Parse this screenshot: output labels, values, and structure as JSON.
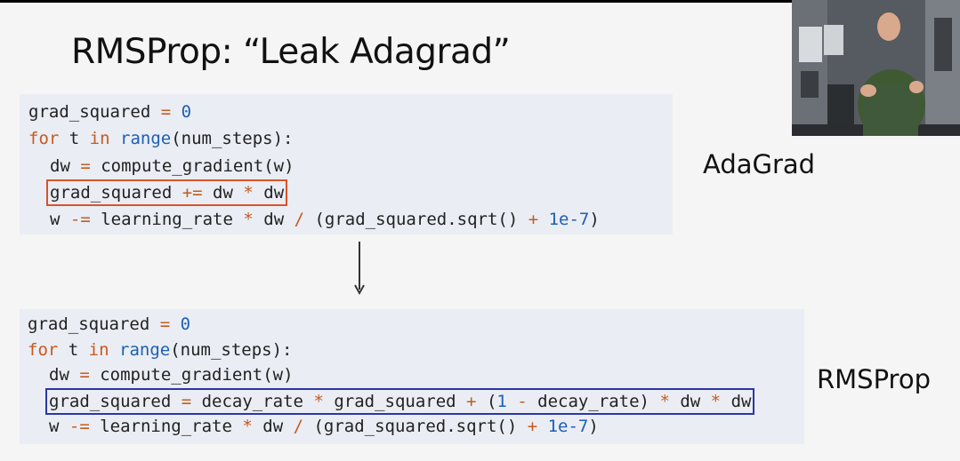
{
  "title": "RMSProp: “Leak Adagrad”",
  "labels": {
    "top": "AdaGrad",
    "bottom": "RMSProp"
  },
  "colors": {
    "keyword": "#c65a1f",
    "builtin": "#1d5fb5",
    "adagrad_box": "#d9532a",
    "rmsprop_box": "#2b36a8"
  },
  "adagrad_code": {
    "l1_a": "grad_squared",
    "l1_eq": " = ",
    "l1_num": "0",
    "l2_for": "for",
    "l2_t": " t ",
    "l2_in": "in",
    "l2_sp": " ",
    "l2_range": "range",
    "l2_rest": "(num_steps):",
    "l3_a": "dw",
    "l3_eq": " = ",
    "l3_b": "compute_gradient(w)",
    "l4_a": "grad_squared",
    "l4_op1": " += ",
    "l4_b": "dw",
    "l4_op2": " * ",
    "l4_c": "dw",
    "l5_a": "w",
    "l5_op1": " -= ",
    "l5_b": "learning_rate",
    "l5_op2": " * ",
    "l5_c": "dw",
    "l5_op3": " / ",
    "l5_d": "(grad_squared.sqrt()",
    "l5_op4": " + ",
    "l5_num": "1e-7",
    "l5_end": ")"
  },
  "rmsprop_code": {
    "l1_a": "grad_squared",
    "l1_eq": " = ",
    "l1_num": "0",
    "l2_for": "for",
    "l2_t": " t ",
    "l2_in": "in",
    "l2_sp": " ",
    "l2_range": "range",
    "l2_rest": "(num_steps):",
    "l3_a": "dw",
    "l3_eq": " = ",
    "l3_b": "compute_gradient(w)",
    "l4_a": "grad_squared",
    "l4_eq": " = ",
    "l4_b": "decay_rate",
    "l4_op1": " * ",
    "l4_c": "grad_squared",
    "l4_op2": " + ",
    "l4_d": "(",
    "l4_num": "1",
    "l4_op3": " - ",
    "l4_e": "decay_rate)",
    "l4_op4": " * ",
    "l4_f": "dw",
    "l4_op5": " * ",
    "l4_g": "dw",
    "l5_a": "w",
    "l5_op1": " -= ",
    "l5_b": "learning_rate",
    "l5_op2": " * ",
    "l5_c": "dw",
    "l5_op3": " / ",
    "l5_d": "(grad_squared.sqrt()",
    "l5_op4": " + ",
    "l5_num": "1e-7",
    "l5_end": ")"
  }
}
